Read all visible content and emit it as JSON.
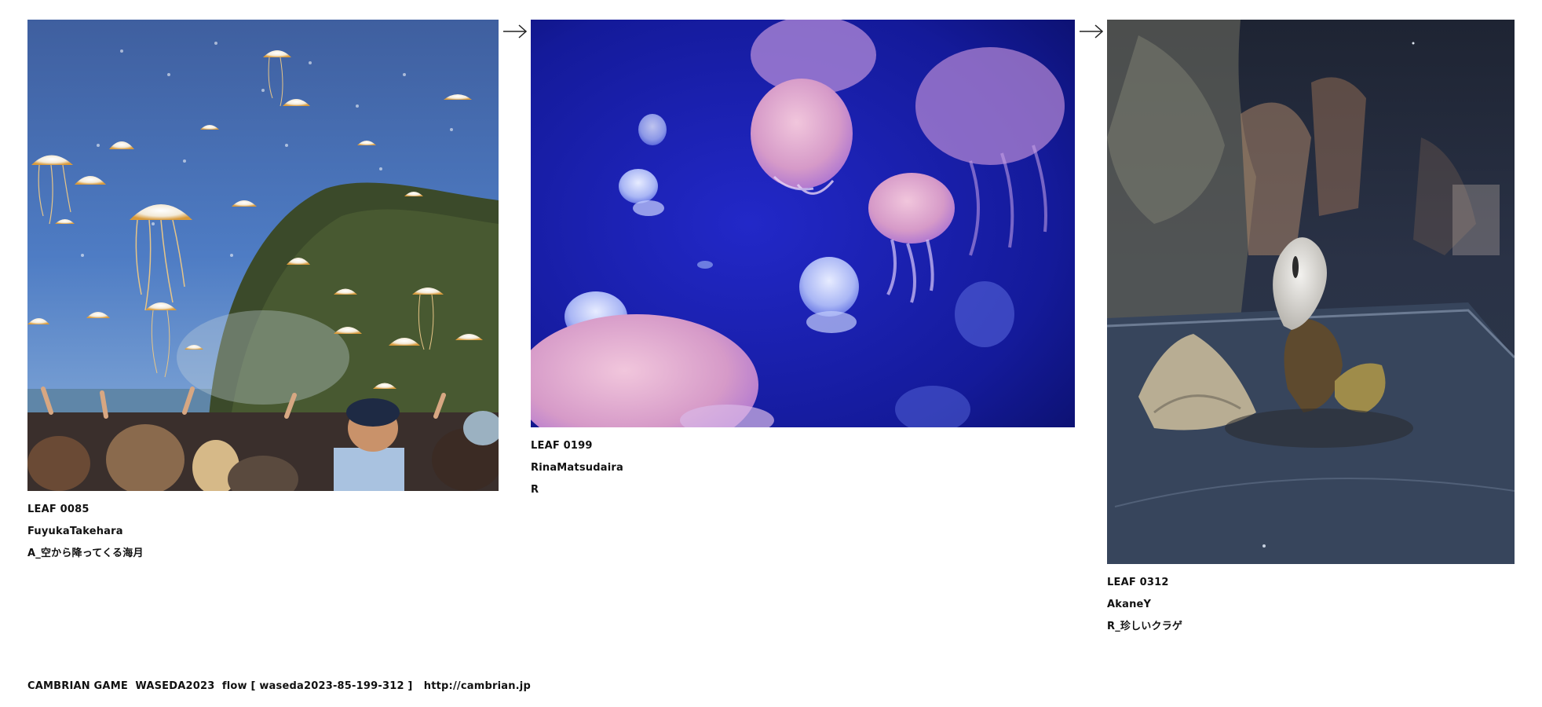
{
  "leaves": [
    {
      "id": "LEAF 0085",
      "author": "FuyukaTakehara",
      "caption": "A_空から降ってくる海月",
      "image": "jellyfish-raining-over-crowd-photo"
    },
    {
      "id": "LEAF 0199",
      "author": "RinaMatsudaira",
      "caption": "R",
      "image": "aquarium-jellyfish-photo"
    },
    {
      "id": "LEAF 0312",
      "author": "AkaneY",
      "caption": "R_珍しいクラゲ",
      "image": "rare-jellyfish-stone-photo"
    }
  ],
  "arrows": [
    "right-arrow-icon",
    "right-arrow-icon"
  ],
  "footer": {
    "text": "CAMBRIAN GAME  WASEDA2023  flow [ waseda2023-85-199-312 ]   ",
    "link": "http://cambrian.jp"
  },
  "colors": {
    "text": "#111111",
    "background": "#ffffff"
  }
}
